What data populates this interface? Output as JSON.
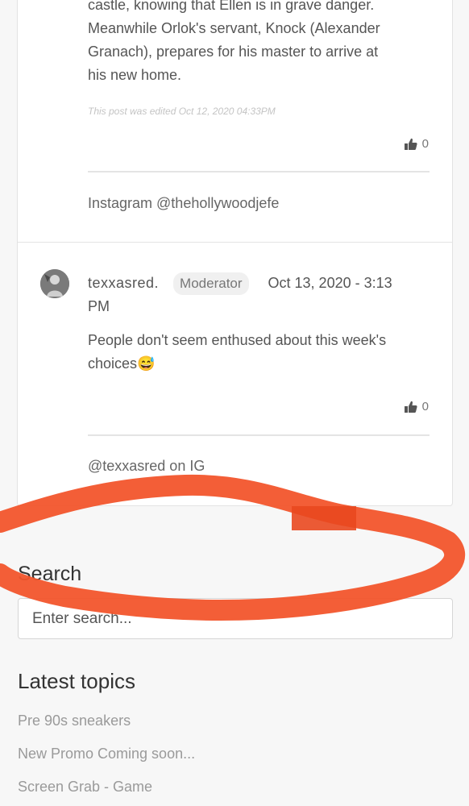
{
  "post1": {
    "body_lines": [
      "castle, knowing that Ellen is in grave danger.",
      "Meanwhile Orlok's servant, Knock (Alexander",
      "Granach), prepares for his master to arrive at",
      "his new home."
    ],
    "edited_note": "This post was edited Oct 12, 2020 04:33PM",
    "like_count": "0",
    "signature": "Instagram @thehollywoodjefe"
  },
  "post2": {
    "username": "texxasred.",
    "role_badge": "Moderator",
    "date_part1": "Oct 13, 2020 - 3:13",
    "date_part2": "PM",
    "body_lines": [
      "People don't seem enthused about this week's",
      "choices😅"
    ],
    "like_count": "0",
    "signature": "@texxasred on IG"
  },
  "search": {
    "heading": "Search",
    "placeholder": "Enter search..."
  },
  "latest_topics": {
    "heading": "Latest topics",
    "items": [
      "Pre 90s sneakers",
      "New Promo Coming soon...",
      "Screen Grab - Game"
    ]
  },
  "icons": {
    "like": "thumbs-up-icon",
    "avatar": "user-avatar"
  },
  "colors": {
    "annotation_stroke": "#f2552c"
  }
}
